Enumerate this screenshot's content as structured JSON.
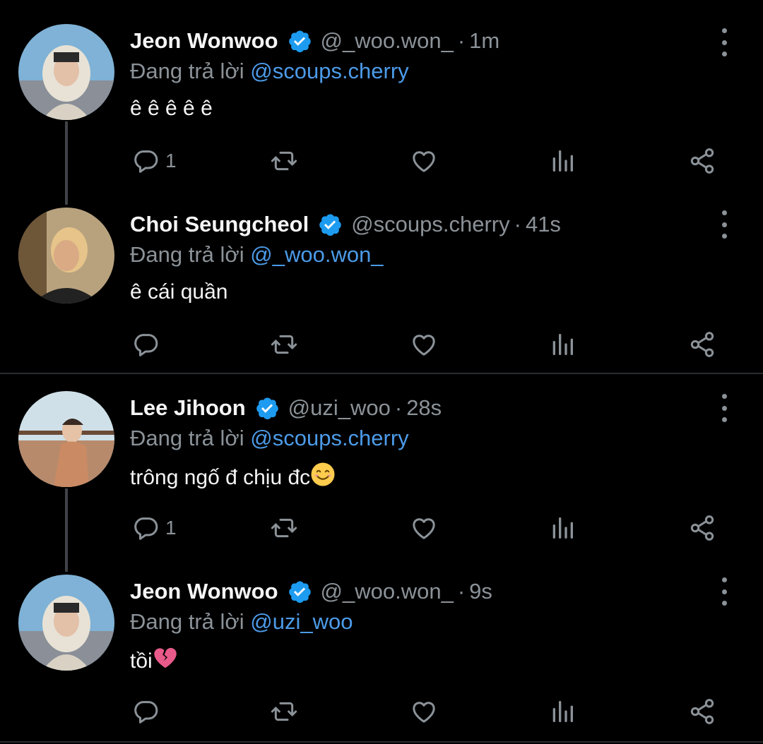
{
  "reply_prefix": "Đang trả lời",
  "colors": {
    "background": "#000000",
    "text": "#e7e9ea",
    "muted": "#8b9298",
    "link": "#4c9be8",
    "verified": "#1d9bf0"
  },
  "tweets": [
    {
      "name": "Jeon Wonwoo",
      "handle": "@_woo.won_",
      "time": "1m",
      "reply_to": "@scoups.cherry",
      "text": "ê ê ê ê ê",
      "reply_count": "1"
    },
    {
      "name": "Choi Seungcheol",
      "handle": "@scoups.cherry",
      "time": "41s",
      "reply_to": "@_woo.won_",
      "text": "ê cái quần",
      "reply_count": ""
    },
    {
      "name": "Lee Jihoon",
      "handle": "@uzi_woo",
      "time": "28s",
      "reply_to": "@scoups.cherry",
      "text": "trông ngố đ chịu đc",
      "emoji": "smiling-face-icon",
      "reply_count": "1"
    },
    {
      "name": "Jeon Wonwoo",
      "handle": "@_woo.won_",
      "time": "9s",
      "reply_to": "@uzi_woo",
      "text": "tồi",
      "emoji": "broken-heart-icon",
      "reply_count": ""
    }
  ]
}
